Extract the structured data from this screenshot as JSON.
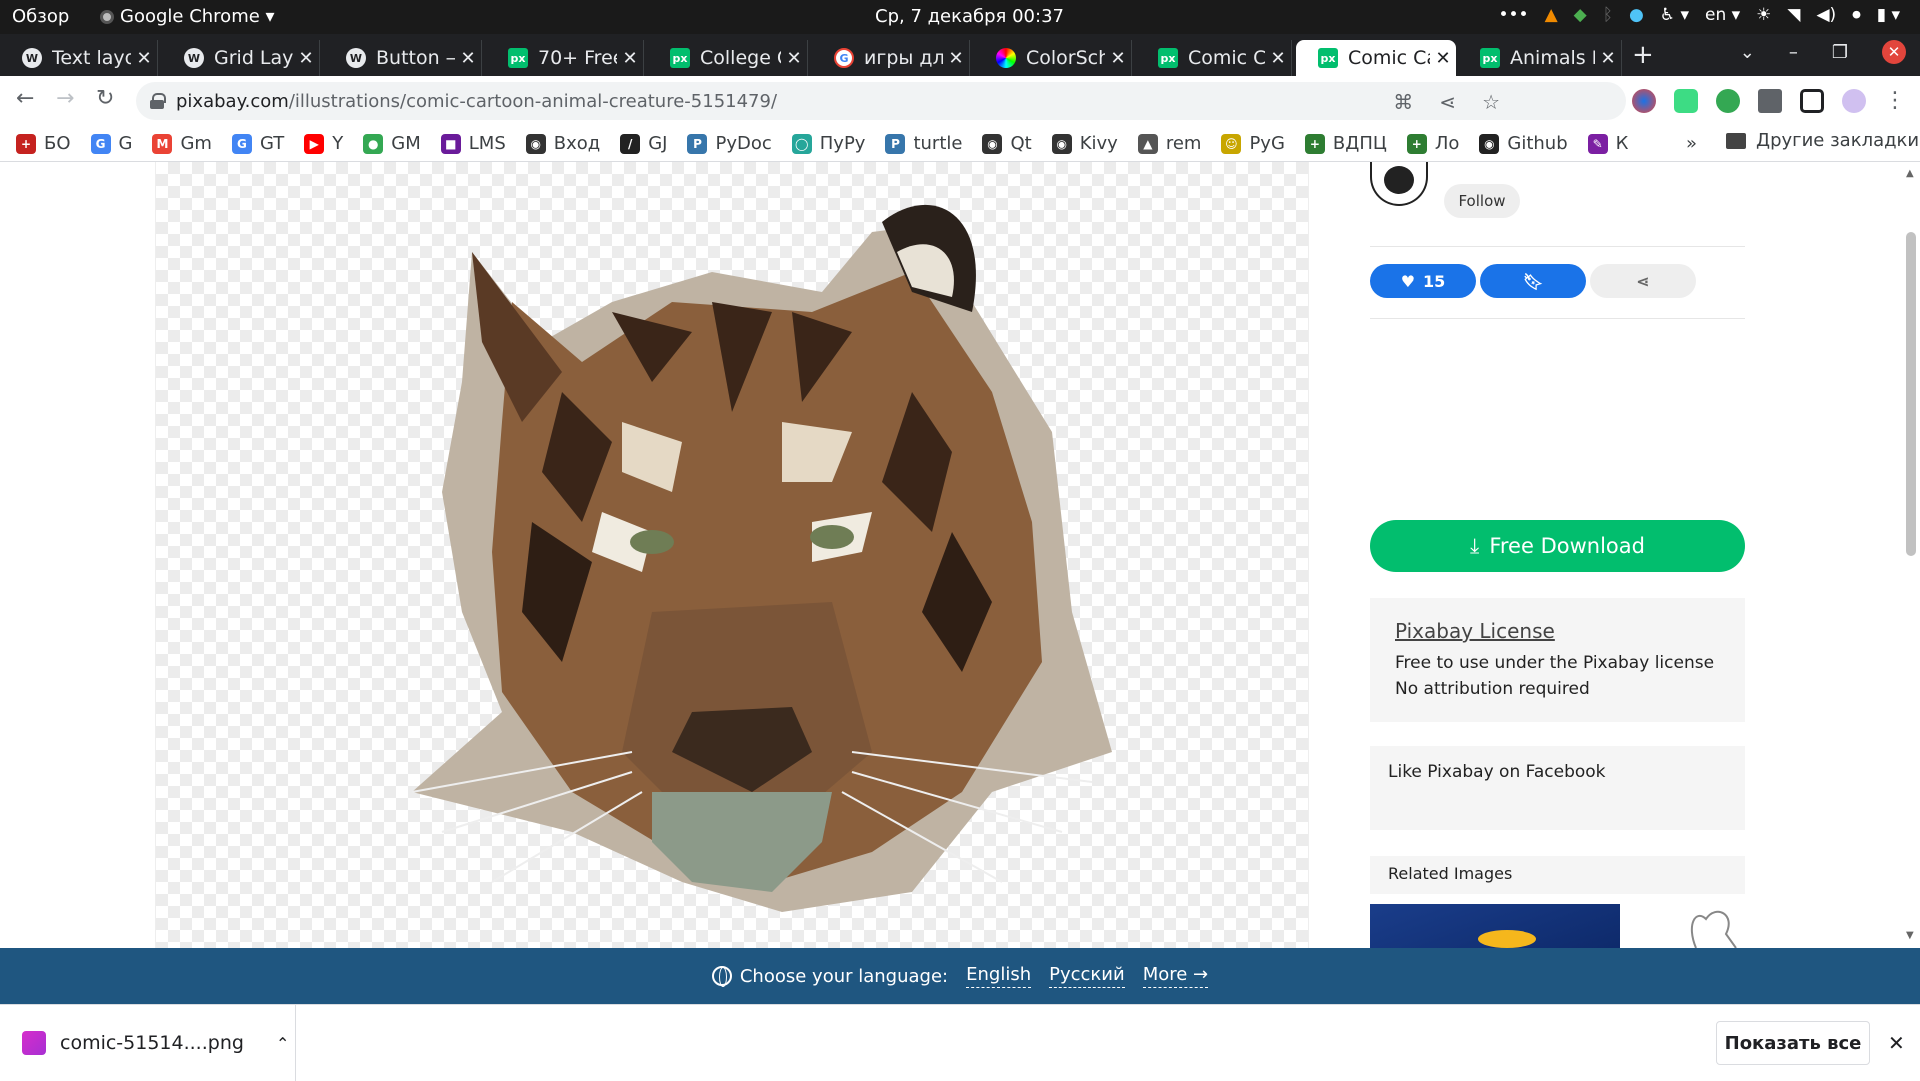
{
  "os": {
    "overview": "Обзор",
    "app": "Google Chrome ▾",
    "clock": "Ср, 7 декабря  00:37",
    "lang": "en ▾"
  },
  "tabs": [
    {
      "label": "Text layo",
      "icon": "wp"
    },
    {
      "label": "Grid Layo",
      "icon": "wp"
    },
    {
      "label": "Button —",
      "icon": "wp"
    },
    {
      "label": "70+ Free",
      "icon": "px"
    },
    {
      "label": "College C",
      "icon": "px"
    },
    {
      "label": "игры для",
      "icon": "g"
    },
    {
      "label": "ColorSche",
      "icon": "cs"
    },
    {
      "label": "Comic Ca",
      "icon": "px"
    },
    {
      "label": "Comic Ca",
      "icon": "px"
    },
    {
      "label": "Animals F",
      "icon": "px"
    }
  ],
  "address": {
    "host": "pixabay.com",
    "path": "/illustrations/comic-cartoon-animal-creature-5151479/"
  },
  "bookmarks": [
    {
      "label": "БО",
      "color": "#c5221f",
      "glyph": "+"
    },
    {
      "label": "G",
      "color": "#4285f4",
      "glyph": "G"
    },
    {
      "label": "Gm",
      "color": "#ea4335",
      "glyph": "M"
    },
    {
      "label": "GT",
      "color": "#4285f4",
      "glyph": "G"
    },
    {
      "label": "Y",
      "color": "#ff0000",
      "glyph": "▶"
    },
    {
      "label": "GM",
      "color": "#34a853",
      "glyph": "●"
    },
    {
      "label": "LMS",
      "color": "#6a1b9a",
      "glyph": "■"
    },
    {
      "label": "Вход",
      "color": "#333333",
      "glyph": "◉"
    },
    {
      "label": "GJ",
      "color": "#222222",
      "glyph": "/"
    },
    {
      "label": "PyDoc",
      "color": "#3776ab",
      "glyph": "P"
    },
    {
      "label": "ПуРу",
      "color": "#26a69a",
      "glyph": "◯"
    },
    {
      "label": "turtle",
      "color": "#3776ab",
      "glyph": "P"
    },
    {
      "label": "Qt",
      "color": "#333333",
      "glyph": "◉"
    },
    {
      "label": "Kivy",
      "color": "#333333",
      "glyph": "◉"
    },
    {
      "label": "rem",
      "color": "#555555",
      "glyph": "▲"
    },
    {
      "label": "PyG",
      "color": "#c8a600",
      "glyph": "☺"
    },
    {
      "label": "ВДПЦ",
      "color": "#2e7d32",
      "glyph": "+"
    },
    {
      "label": "Ло",
      "color": "#2e7d32",
      "glyph": "+"
    },
    {
      "label": "Github",
      "color": "#222222",
      "glyph": "◉"
    },
    {
      "label": "К",
      "color": "#7b1fa2",
      "glyph": "✎"
    }
  ],
  "bookmarks_more": "»",
  "bookmarks_other": "Другие закладки",
  "sidebar": {
    "follow": "Follow",
    "likes": "15",
    "download": "Free Download",
    "license_title": "Pixabay License",
    "license_line1": "Free to use under the Pixabay license",
    "license_line2": "No attribution required",
    "facebook": "Like Pixabay on Facebook",
    "related": "Related Images"
  },
  "langbar": {
    "prompt": "Choose your language:",
    "english": "English",
    "russian": "Русский",
    "more": "More →"
  },
  "shelf": {
    "file": "comic-51514....png",
    "show_all": "Показать все"
  }
}
